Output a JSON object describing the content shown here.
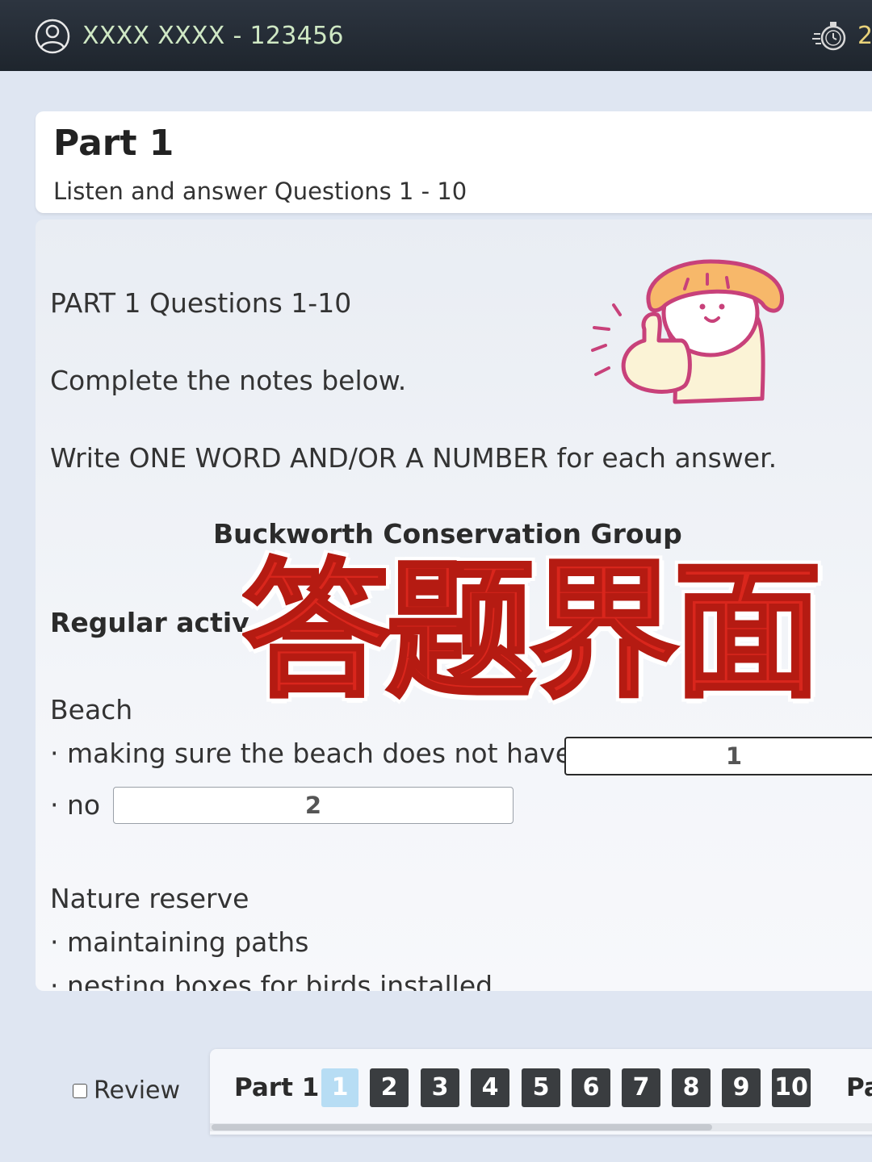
{
  "header": {
    "candidate": "XXXX XXXX - 123456",
    "timer": "2",
    "icons": [
      "user-icon",
      "stopwatch-icon"
    ]
  },
  "part": {
    "title": "Part 1",
    "subtitle": "Listen and answer Questions 1 - 10"
  },
  "content": {
    "heading": "PART 1 Questions 1-10",
    "instruction1": "Complete the notes below.",
    "instruction2": "Write ONE WORD AND/OR A NUMBER for each answer.",
    "notes_title": "Buckworth Conservation Group",
    "section": "Regular activ",
    "beach_label": "Beach",
    "beach_item1": "· making sure the beach does not have",
    "beach_item2": "· no",
    "nature_label": "Nature reserve",
    "nature_item1": "· maintaining paths",
    "nature_item2": "· nesting boxes for birds installed"
  },
  "answers": [
    {
      "number": "1",
      "value": ""
    },
    {
      "number": "2",
      "value": ""
    }
  ],
  "overlay_text": "答题界面",
  "footer": {
    "review_label": "Review",
    "part_label": "Part 1:",
    "questions": [
      "1",
      "2",
      "3",
      "4",
      "5",
      "6",
      "7",
      "8",
      "9",
      "10"
    ],
    "current_question": "1",
    "next_part_label": "Pa"
  },
  "colors": {
    "overlay_red": "#d9261c",
    "question_button": "#3a3d40",
    "active_question": "#b7ddf4",
    "topbar": "#252c35"
  }
}
